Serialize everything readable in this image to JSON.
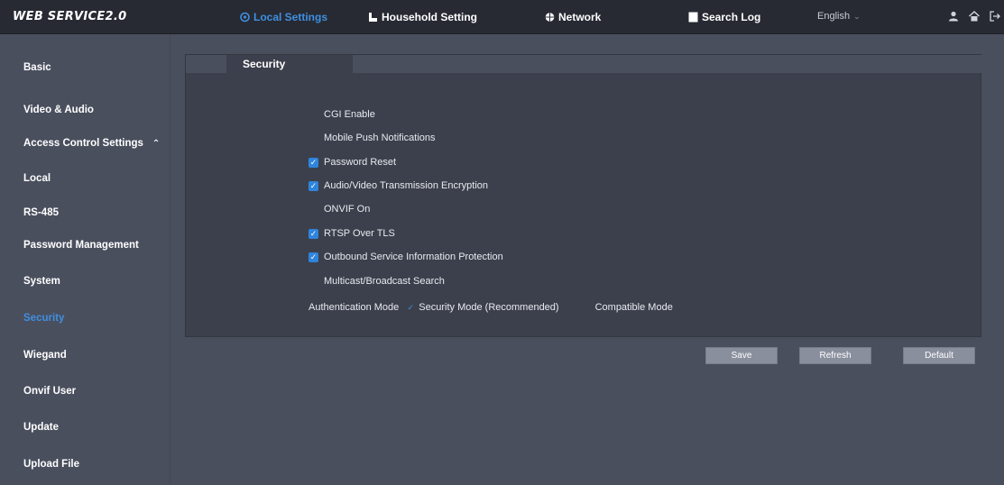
{
  "app": {
    "brand": "WEB SERVICE2.0"
  },
  "nav": {
    "local_settings": "Local Settings",
    "household_setting": "Household Setting",
    "network": "Network",
    "search_log": "Search Log",
    "language": "English"
  },
  "sidebar": {
    "items": [
      {
        "label": "Basic"
      },
      {
        "label": "Video & Audio"
      },
      {
        "label": "Access Control Settings"
      },
      {
        "label": "Local"
      },
      {
        "label": "RS-485"
      },
      {
        "label": "Password Management"
      },
      {
        "label": "System"
      },
      {
        "label": "Security"
      },
      {
        "label": "Wiegand"
      },
      {
        "label": "Onvif User"
      },
      {
        "label": "Update"
      },
      {
        "label": "Upload File"
      }
    ],
    "selected": "Security"
  },
  "main": {
    "tab": "Security",
    "options": [
      {
        "label": "CGI Enable",
        "checked": false
      },
      {
        "label": "Mobile Push Notifications",
        "checked": false
      },
      {
        "label": "Password Reset",
        "checked": true
      },
      {
        "label": "Audio/Video Transmission Encryption",
        "checked": true
      },
      {
        "label": "ONVIF On",
        "checked": false
      },
      {
        "label": "RTSP Over TLS",
        "checked": true
      },
      {
        "label": "Outbound Service Information Protection",
        "checked": true
      },
      {
        "label": "Multicast/Broadcast Search",
        "checked": false
      }
    ],
    "auth": {
      "label": "Authentication Mode",
      "security_mode": "Security Mode (Recommended)",
      "compatible_mode": "Compatible Mode",
      "selected": "Security Mode (Recommended)"
    }
  },
  "buttons": {
    "save": "Save",
    "refresh": "Refresh",
    "default": "Default"
  },
  "colors": {
    "accent": "#3f8fe0",
    "topbar": "#272a33",
    "background": "#4a4f5e",
    "panel": "#3c404c",
    "checkbox": "#2f84dd",
    "button": "#8a8f9e"
  }
}
